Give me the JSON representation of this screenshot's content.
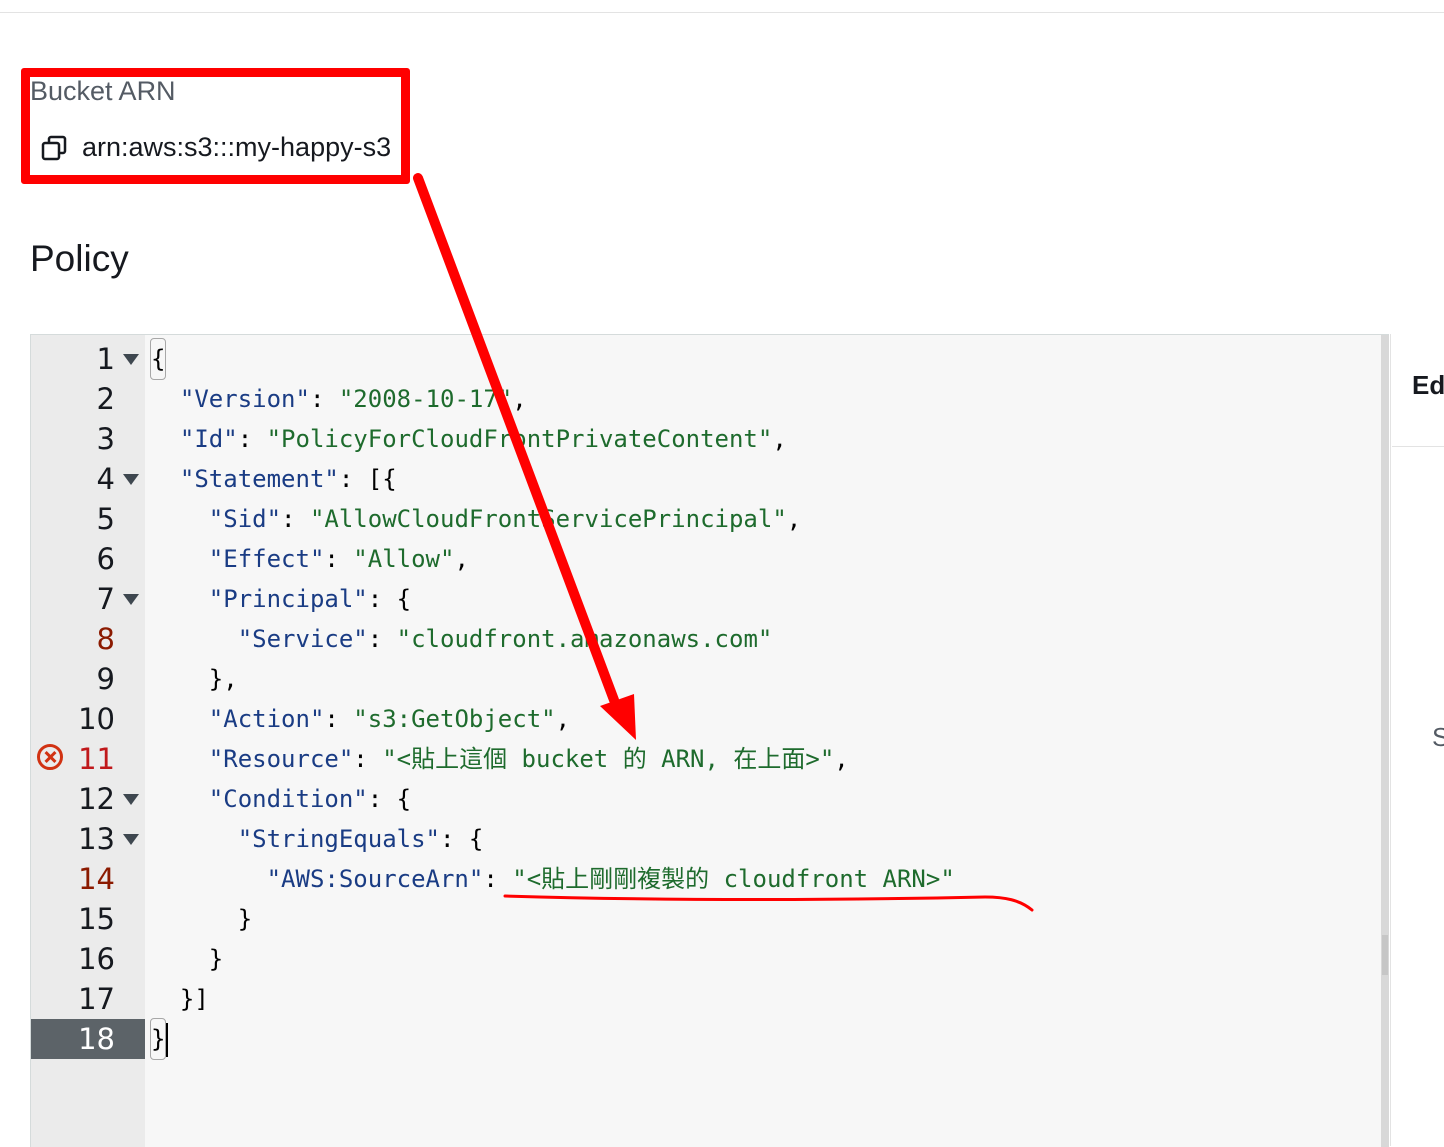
{
  "bucket": {
    "label": "Bucket ARN",
    "arn": "arn:aws:s3:::my-happy-s3"
  },
  "policy": {
    "heading": "Policy"
  },
  "editor": {
    "lines": [
      {
        "n": "1"
      },
      {
        "n": "2"
      },
      {
        "n": "3"
      },
      {
        "n": "4"
      },
      {
        "n": "5"
      },
      {
        "n": "6"
      },
      {
        "n": "7"
      },
      {
        "n": "8"
      },
      {
        "n": "9"
      },
      {
        "n": "10"
      },
      {
        "n": "11"
      },
      {
        "n": "12"
      },
      {
        "n": "13"
      },
      {
        "n": "14"
      },
      {
        "n": "15"
      },
      {
        "n": "16"
      },
      {
        "n": "17"
      },
      {
        "n": "18"
      }
    ],
    "tokens": {
      "l1": "{",
      "l2k": "\"Version\"",
      "l2v": "\"2008-10-17\"",
      "l3k": "\"Id\"",
      "l3v": "\"PolicyForCloudFrontPrivateContent\"",
      "l4k": "\"Statement\"",
      "l5k": "\"Sid\"",
      "l5v": "\"AllowCloudFrontServicePrincipal\"",
      "l6k": "\"Effect\"",
      "l6v": "\"Allow\"",
      "l7k": "\"Principal\"",
      "l8k": "\"Service\"",
      "l8v": "\"cloudfront.amazonaws.com\"",
      "l9": "},",
      "l10k": "\"Action\"",
      "l10v": "\"s3:GetObject\"",
      "l11k": "\"Resource\"",
      "l11v": "\"<貼上這個 bucket 的 ARN, 在上面>\"",
      "l12k": "\"Condition\"",
      "l13k": "\"StringEquals\"",
      "l14k": "\"AWS:SourceArn\"",
      "l14v": "\"<貼上剛剛複製的 cloudfront ARN>\"",
      "l15": "}",
      "l16": "}",
      "l17": "}]",
      "l18": "}"
    }
  },
  "side": {
    "title": "Ed",
    "letter": "S"
  },
  "colors": {
    "annotation": "#ff0000",
    "key": "#1a3c84",
    "string": "#1e6b2d",
    "error": "#d13212"
  },
  "icons": [
    "copy-icon",
    "fold-arrow-icon",
    "error-icon"
  ]
}
